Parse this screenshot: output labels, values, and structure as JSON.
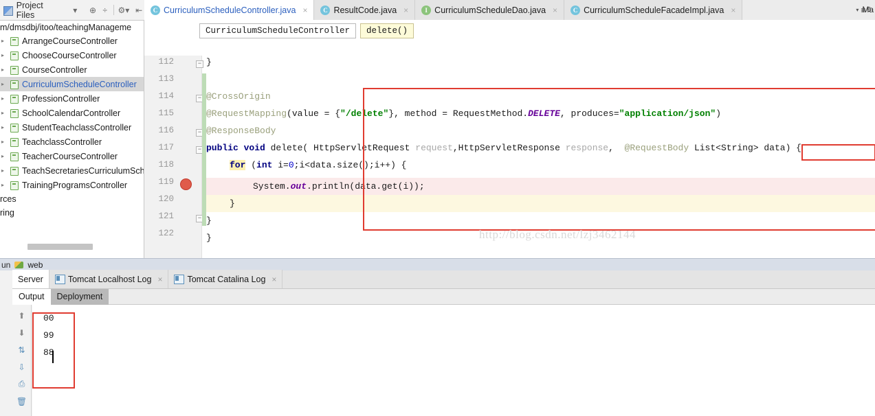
{
  "toolbar": {
    "project_files_label": "Project Files",
    "dropdown_icon": "chevron-down-icon",
    "locate_icon": "target-icon",
    "collapse_icon": "collapse-all-icon",
    "settings_icon": "gear-icon",
    "hide_icon": "hide-panel-icon"
  },
  "tabs": [
    {
      "label": "CurriculumScheduleController.java",
      "icon": "class-icon",
      "icon_letter": "C",
      "active": true
    },
    {
      "label": "ResultCode.java",
      "icon": "class-icon",
      "icon_letter": "C",
      "active": false
    },
    {
      "label": "CurriculumScheduleDao.java",
      "icon": "interface-icon",
      "icon_letter": "I",
      "active": false
    },
    {
      "label": "CurriculumScheduleFacadeImpl.java",
      "icon": "class-icon",
      "icon_letter": "C",
      "active": false
    }
  ],
  "tab_overflow": {
    "arrow": "▾",
    "lines": "≡",
    "count": "6"
  },
  "maven_label": "Ma",
  "sidebar": {
    "path": "m/dmsdbj/itoo/teachingManageme",
    "items": [
      {
        "label": "ArrangeCourseController",
        "selected": false
      },
      {
        "label": "ChooseCourseController",
        "selected": false
      },
      {
        "label": "CourseController",
        "selected": false
      },
      {
        "label": "CurriculumScheduleController",
        "selected": true
      },
      {
        "label": "ProfessionController",
        "selected": false
      },
      {
        "label": "SchoolCalendarController",
        "selected": false
      },
      {
        "label": "StudentTeachclassController",
        "selected": false
      },
      {
        "label": "TeachclassController",
        "selected": false
      },
      {
        "label": "TeacherCourseController",
        "selected": false
      },
      {
        "label": "TeachSecretariesCurriculumSche",
        "selected": false
      },
      {
        "label": "TrainingProgramsController",
        "selected": false
      }
    ],
    "footer_items": [
      "rces",
      "ring"
    ]
  },
  "breadcrumb": {
    "class": "CurriculumScheduleController",
    "method": "delete()"
  },
  "editor": {
    "line_numbers": [
      "112",
      "113",
      "114",
      "115",
      "116",
      "117",
      "118",
      "119",
      "120",
      "121",
      "122"
    ],
    "breakpoint_line": "119",
    "watermark": "http://blog.csdn.net/lzj3462144",
    "code_lines": [
      {
        "n": "112",
        "text": "}"
      },
      {
        "n": "113",
        "text": ""
      },
      {
        "n": "114",
        "text": "@CrossOrigin"
      },
      {
        "n": "115",
        "text": "@RequestMapping(value = {\"/delete\"}, method = RequestMethod.DELETE, produces=\"application/json\")"
      },
      {
        "n": "116",
        "text": "@ResponseBody"
      },
      {
        "n": "117",
        "text": "public void delete( HttpServletRequest request,HttpServletResponse response,  @RequestBody List<String> data) {"
      },
      {
        "n": "118",
        "text": "    for (int i=0;i<data.size();i++) {"
      },
      {
        "n": "119",
        "text": "        System.out.println(data.get(i));"
      },
      {
        "n": "120",
        "text": "    }"
      },
      {
        "n": "121",
        "text": "}"
      },
      {
        "n": "122",
        "text": "}"
      }
    ],
    "annotation_highlight": "@RequestBody"
  },
  "runbar": {
    "run_label": "un",
    "app_label": "web",
    "cat_icon": "tomcat-icon"
  },
  "console": {
    "tabs": [
      {
        "label": "Server",
        "active": true,
        "closable": false,
        "icon": null
      },
      {
        "label": "Tomcat Localhost Log",
        "active": false,
        "closable": true,
        "icon": "log-icon"
      },
      {
        "label": "Tomcat Catalina Log",
        "active": false,
        "closable": true,
        "icon": "log-icon"
      }
    ],
    "subtabs": [
      {
        "label": "Output",
        "active": true
      },
      {
        "label": "Deployment",
        "active": false
      }
    ],
    "output_lines": [
      "00",
      "99",
      "88"
    ],
    "toolbar_icons": [
      "scroll-up-icon",
      "scroll-down-icon",
      "soft-wrap-icon",
      "export-icon",
      "print-icon",
      "clear-all-icon"
    ],
    "rail_icons": [
      "rerun-icon",
      "restart-icon",
      "thread-dump-icon",
      "stop-icon",
      "close-icon",
      "help-icon"
    ]
  },
  "colors": {
    "accent_blue": "#2b5fbe",
    "annotation": "#9aa07c",
    "string_green": "#008000",
    "keyword_navy": "#000080",
    "static_purple": "#660099",
    "highlight_red": "#e03b30",
    "breakpoint_red": "#e05b4a",
    "changebar_green": "#bddcb6",
    "marker_orange": "#f0a030",
    "tab_active_bg": "#ffffff",
    "panel_bg": "#f2f2f2"
  }
}
